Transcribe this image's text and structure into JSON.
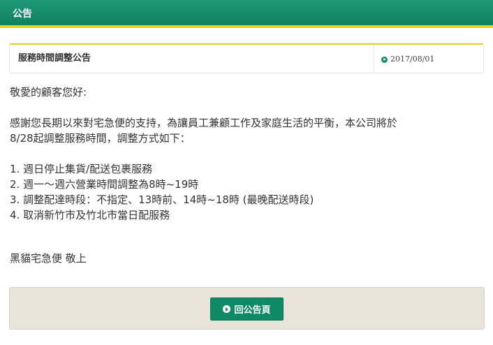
{
  "header": {
    "title": "公告"
  },
  "notice": {
    "title": "服務時間調整公告",
    "date": "2017/08/01"
  },
  "content": {
    "greeting": "敬愛的顧客您好:",
    "intro_line1": "感謝您長期以來對宅急便的支持，為讓員工兼顧工作及家庭生活的平衡，本公司將於",
    "intro_line2": "8/28起調整服務時間，調整方式如下：",
    "items": [
      "1. 週日停止集貨/配送包裹服務",
      "2. 週一～週六營業時間調整為8時~19時",
      "3. 調整配達時段：不指定、13時前、14時~18時 (最晚配送時段)",
      "4. 取消新竹市及竹北市當日配服務"
    ],
    "signature": "黑貓宅急便 敬上"
  },
  "footer": {
    "back_label": "回公告頁"
  },
  "icons": {
    "date_icon": "circle-arrow-icon",
    "back_icon": "circle-play-icon"
  },
  "colors": {
    "brand_green": "#0e8a66",
    "accent_yellow": "#e6cf1a",
    "footer_bg": "#e9e4da"
  }
}
